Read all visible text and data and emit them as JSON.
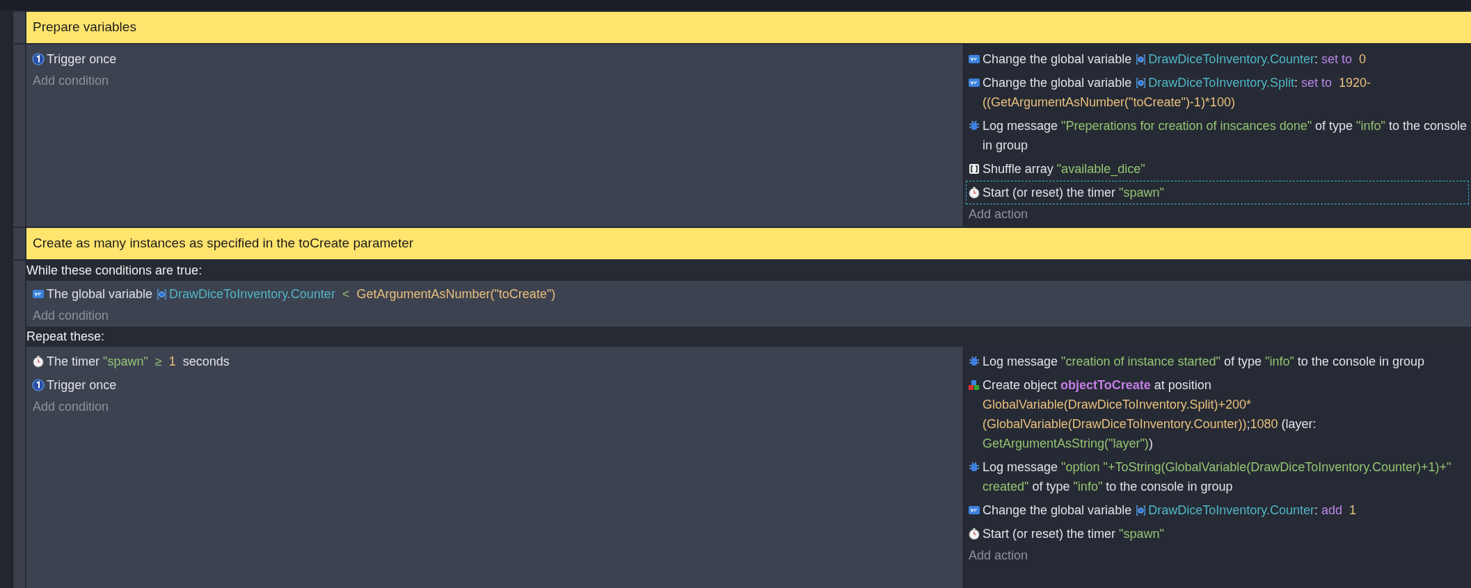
{
  "events": [
    {
      "kind": "comment",
      "text": "Prepare variables"
    },
    {
      "kind": "standard",
      "conditions": [
        {
          "kind": "trigger",
          "selected": false,
          "parts": [
            {
              "kind": "text",
              "text": "Trigger once"
            }
          ]
        }
      ],
      "add_condition": "Add condition",
      "actions": [
        {
          "kind": "variable",
          "selected": false,
          "parts": [
            {
              "kind": "text",
              "text": "Change the global variable "
            },
            {
              "kind": "scope"
            },
            {
              "kind": "variable",
              "text": "DrawDiceToInventory.Counter"
            },
            {
              "kind": "text",
              "text": ": "
            },
            {
              "kind": "operator",
              "text": "set to "
            },
            {
              "kind": "number",
              "text": " 0"
            }
          ]
        },
        {
          "kind": "variable",
          "selected": false,
          "parts": [
            {
              "kind": "text",
              "text": "Change the global variable "
            },
            {
              "kind": "scope"
            },
            {
              "kind": "variable",
              "text": "DrawDiceToInventory.Split"
            },
            {
              "kind": "text",
              "text": ": "
            },
            {
              "kind": "operator",
              "text": "set to "
            },
            {
              "kind": "number",
              "text": " 1920-((GetArgumentAsNumber(\"toCreate\")-1)*100)"
            }
          ]
        },
        {
          "kind": "log",
          "selected": false,
          "parts": [
            {
              "kind": "text",
              "text": "Log message "
            },
            {
              "kind": "string",
              "text": "\"Preperations for creation of inscances done\""
            },
            {
              "kind": "text",
              "text": " of type "
            },
            {
              "kind": "string",
              "text": "\"info\""
            },
            {
              "kind": "text",
              "text": " to the console in group"
            }
          ]
        },
        {
          "kind": "array",
          "selected": false,
          "parts": [
            {
              "kind": "text",
              "text": "Shuffle array "
            },
            {
              "kind": "string",
              "text": "\"available_dice\""
            }
          ]
        },
        {
          "kind": "timer",
          "selected": true,
          "parts": [
            {
              "kind": "text",
              "text": "Start (or reset) the timer "
            },
            {
              "kind": "string",
              "text": "\"spawn\""
            }
          ]
        }
      ],
      "add_action": "Add action"
    },
    {
      "kind": "comment",
      "text": "Create as many instances as specified in the toCreate parameter"
    },
    {
      "kind": "while",
      "while_label": "While these conditions are true:",
      "while_conditions": [
        {
          "kind": "variable",
          "selected": false,
          "parts": [
            {
              "kind": "text",
              "text": "The global variable "
            },
            {
              "kind": "scope"
            },
            {
              "kind": "variable",
              "text": "DrawDiceToInventory.Counter"
            },
            {
              "kind": "symbol",
              "text": "  <  "
            },
            {
              "kind": "number",
              "text": "GetArgumentAsNumber(\"toCreate\")"
            }
          ]
        }
      ],
      "add_while_condition": "Add condition",
      "repeat_label": "Repeat these:",
      "conditions": [
        {
          "kind": "timer",
          "selected": false,
          "parts": [
            {
              "kind": "text",
              "text": "The timer "
            },
            {
              "kind": "string",
              "text": "\"spawn\""
            },
            {
              "kind": "symbol",
              "text": "  ≥  "
            },
            {
              "kind": "number",
              "text": "1"
            },
            {
              "kind": "text",
              "text": "  seconds"
            }
          ]
        },
        {
          "kind": "trigger",
          "selected": false,
          "parts": [
            {
              "kind": "text",
              "text": "Trigger once"
            }
          ]
        }
      ],
      "add_condition": "Add condition",
      "actions": [
        {
          "kind": "log",
          "selected": false,
          "parts": [
            {
              "kind": "text",
              "text": "Log message "
            },
            {
              "kind": "string",
              "text": "\"creation of instance started\""
            },
            {
              "kind": "text",
              "text": " of type "
            },
            {
              "kind": "string",
              "text": "\"info\""
            },
            {
              "kind": "text",
              "text": " to the console in group"
            }
          ]
        },
        {
          "kind": "create",
          "selected": false,
          "parts": [
            {
              "kind": "text",
              "text": "Create object "
            },
            {
              "kind": "object",
              "text": "objectToCreate"
            },
            {
              "kind": "text",
              "text": " at position "
            },
            {
              "kind": "number",
              "text": "GlobalVariable(DrawDiceToInventory.Split)+200*(GlobalVariable(DrawDiceToInventory.Counter))"
            },
            {
              "kind": "text",
              "text": ";"
            },
            {
              "kind": "number",
              "text": "1080"
            },
            {
              "kind": "text",
              "text": " (layer: "
            },
            {
              "kind": "string",
              "text": "GetArgumentAsString(\"layer\")"
            },
            {
              "kind": "text",
              "text": ")"
            }
          ]
        },
        {
          "kind": "log",
          "selected": false,
          "parts": [
            {
              "kind": "text",
              "text": "Log message "
            },
            {
              "kind": "string",
              "text": "\"option \"+ToString(GlobalVariable(DrawDiceToInventory.Counter)+1)+\" created\""
            },
            {
              "kind": "text",
              "text": " of type "
            },
            {
              "kind": "string",
              "text": "\"info\""
            },
            {
              "kind": "text",
              "text": " to the console in group"
            }
          ]
        },
        {
          "kind": "variable",
          "selected": false,
          "parts": [
            {
              "kind": "text",
              "text": "Change the global variable "
            },
            {
              "kind": "scope"
            },
            {
              "kind": "variable",
              "text": "DrawDiceToInventory.Counter"
            },
            {
              "kind": "text",
              "text": ": "
            },
            {
              "kind": "operator",
              "text": "add "
            },
            {
              "kind": "number",
              "text": " 1"
            }
          ]
        },
        {
          "kind": "timer",
          "selected": false,
          "parts": [
            {
              "kind": "text",
              "text": "Start (or reset) the timer "
            },
            {
              "kind": "string",
              "text": "\"spawn\""
            }
          ]
        }
      ],
      "add_action": "Add action"
    }
  ]
}
